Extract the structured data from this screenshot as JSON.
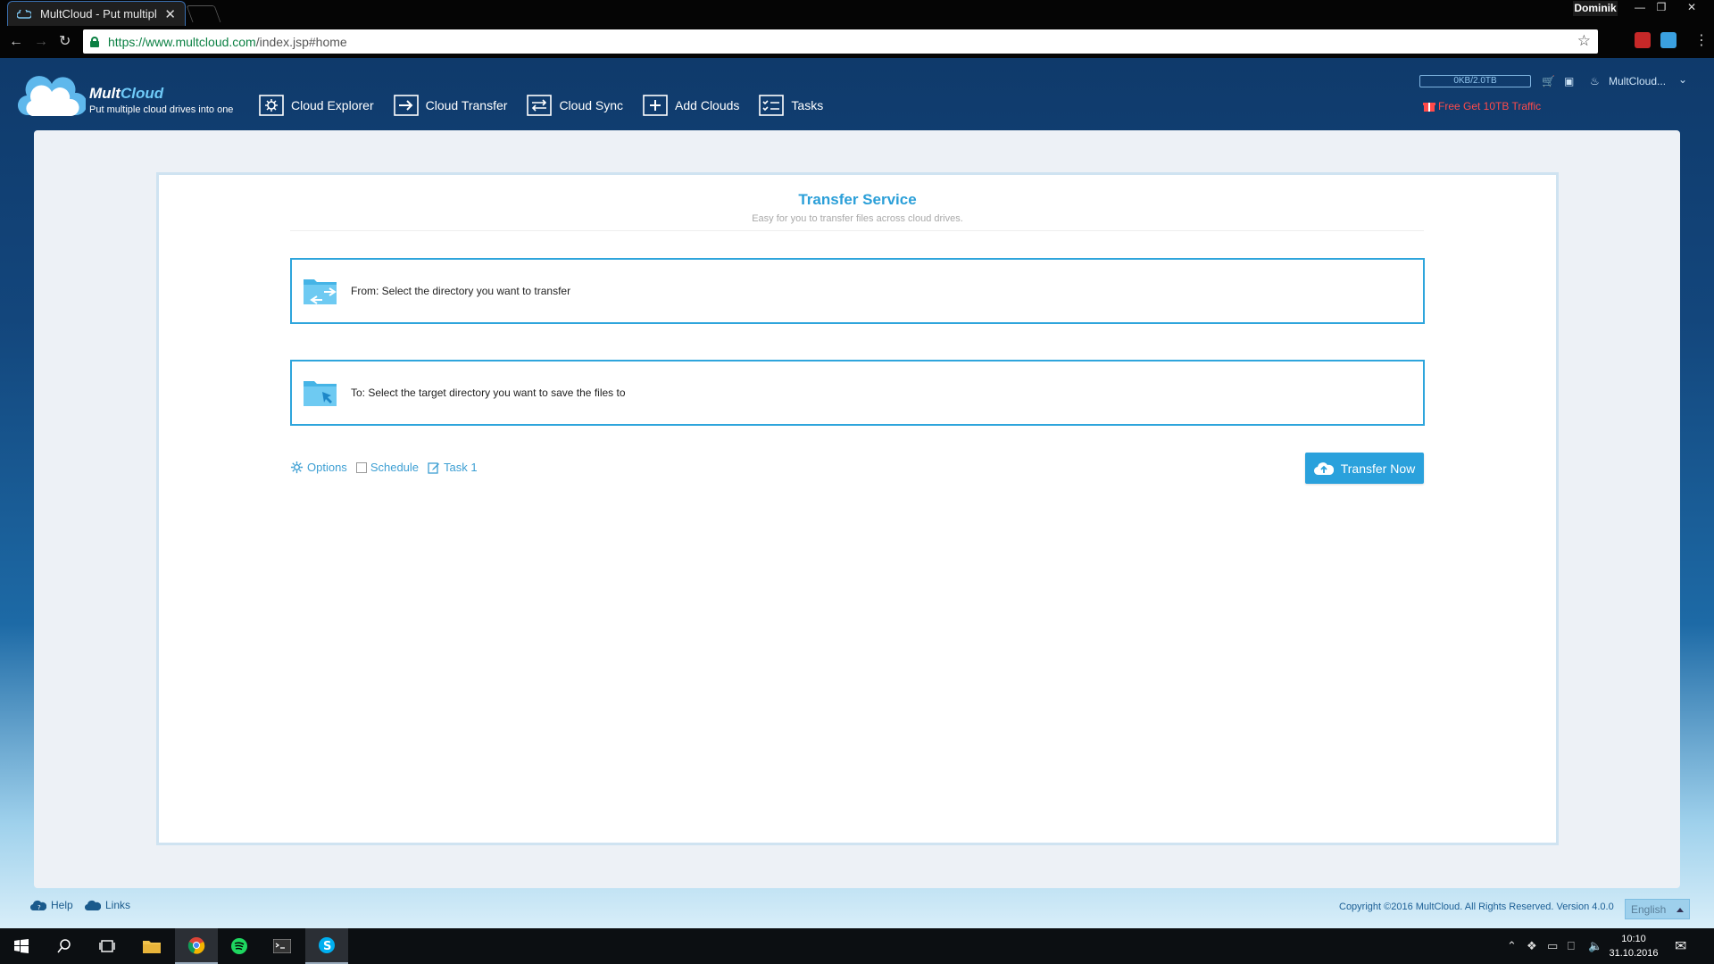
{
  "browser": {
    "tab_title": "MultCloud - Put multiple",
    "tab_close": "✕",
    "profile": "Dominik",
    "url_main": "https://www.multcloud.com",
    "url_rest": "/index.jsp#home"
  },
  "header": {
    "brand_mult": "Mult",
    "brand_cloud": "Cloud",
    "tagline": "Put multiple cloud drives into one",
    "nav": [
      {
        "label": "Cloud Explorer",
        "icon": "gear-icon"
      },
      {
        "label": "Cloud Transfer",
        "icon": "transfer-arrow-icon"
      },
      {
        "label": "Cloud Sync",
        "icon": "sync-icon"
      },
      {
        "label": "Add Clouds",
        "icon": "plus-icon"
      },
      {
        "label": "Tasks",
        "icon": "tasks-icon"
      }
    ],
    "traffic": "0KB/2.0TB",
    "user": "MultCloud...",
    "free_traffic": "Free Get 10TB Traffic"
  },
  "transfer": {
    "title": "Transfer Service",
    "subtitle": "Easy for you to transfer files across cloud drives.",
    "from_label": "From: Select the directory you want to transfer",
    "to_label": "To: Select the target directory you want to save the files to",
    "options_label": "Options",
    "schedule_label": "Schedule",
    "task_label": "Task 1",
    "button_label": "Transfer Now"
  },
  "footer": {
    "help": "Help",
    "links": "Links",
    "copyright": "Copyright ©2016 MultCloud. All Rights Reserved. Version 4.0.0",
    "language": "English"
  },
  "taskbar": {
    "time": "10:10",
    "date": "31.10.2016"
  },
  "colors": {
    "accent": "#2aa1dc",
    "header_dark": "#0f3a6b",
    "free_red": "#ff4a4a"
  }
}
